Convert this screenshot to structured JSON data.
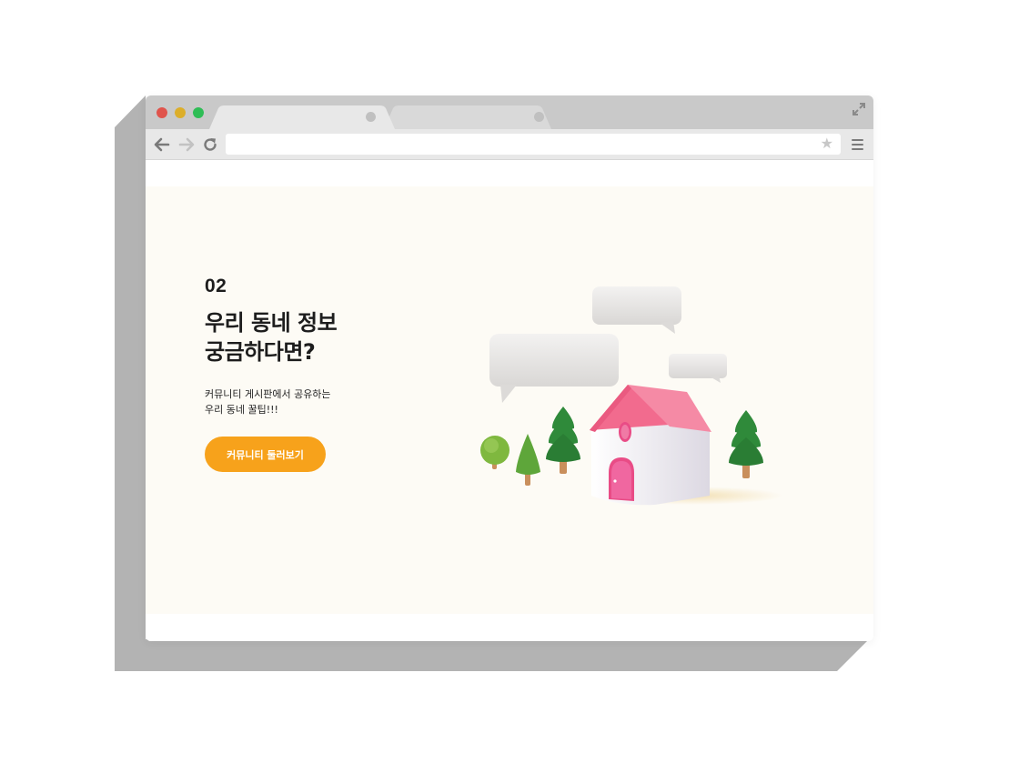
{
  "browser": {
    "tabs": [
      "",
      ""
    ],
    "address": "",
    "icons": [
      "back-icon",
      "forward-icon",
      "reload-icon",
      "star-icon",
      "menu-icon",
      "expand-icon"
    ]
  },
  "hero": {
    "number": "02",
    "title_lines": [
      "우리 동네 정보",
      "궁금하다면?"
    ],
    "desc_lines": [
      "커뮤니티 게시판에서 공유하는",
      "우리 동네 꿀팁!!!"
    ],
    "cta_label": "커뮤니티 둘러보기"
  },
  "colors": {
    "accent": "#f7a21b",
    "hero_bg": "#fdfbf5",
    "roof": "#f26b8e",
    "door": "#e94c86",
    "tree_dark": "#2f8a3a",
    "tree_light": "#6cb13e",
    "titlebar": "#c9c9c9",
    "toolbar": "#e8e8e8"
  }
}
